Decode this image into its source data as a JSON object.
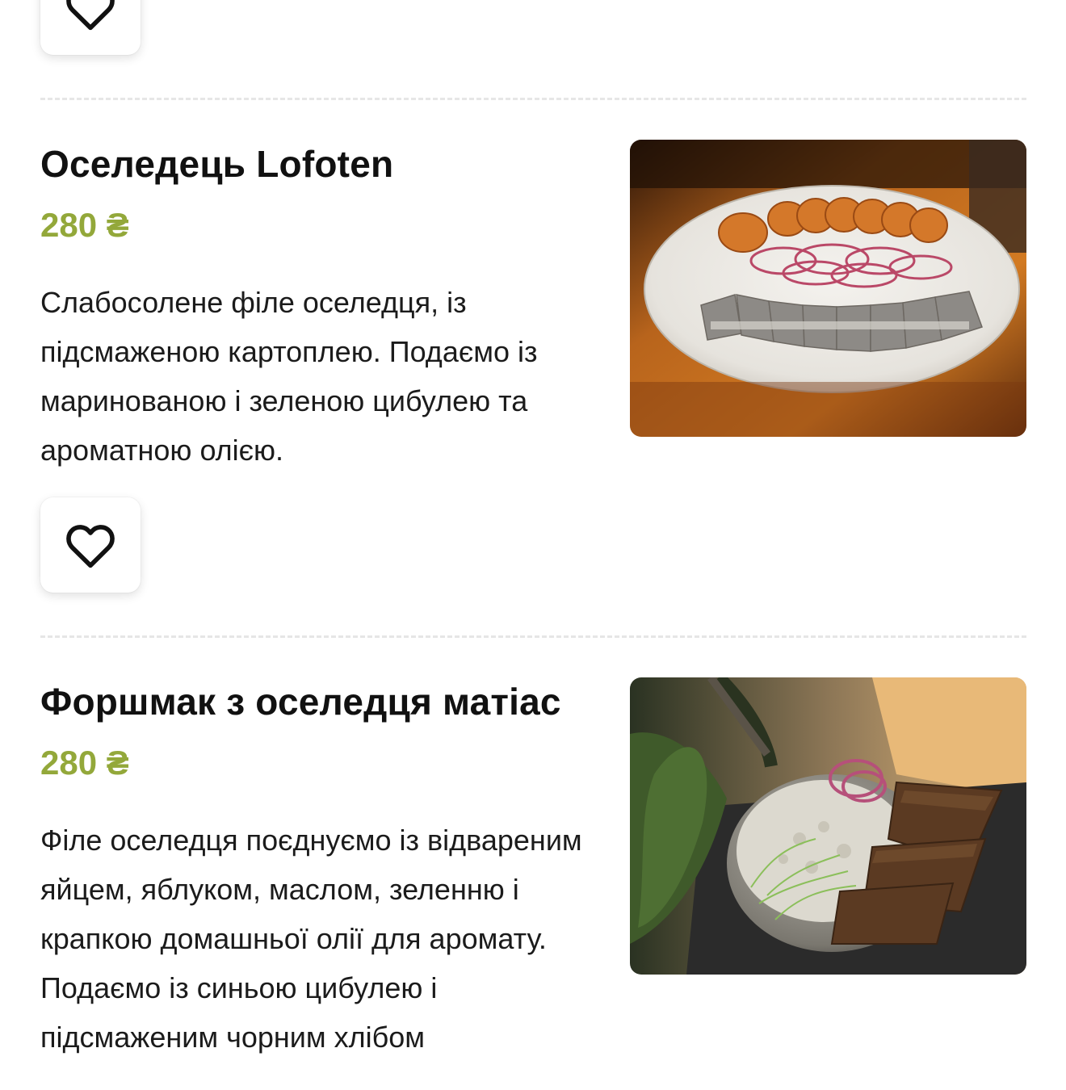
{
  "currency_symbol": "₴",
  "colors": {
    "price_accent": "#93a83a",
    "divider": "#e6e6e6",
    "text": "#151515"
  },
  "icons": {
    "favorite": "heart-outline-icon"
  },
  "menu_items": [
    {
      "title": "Оселедець Lofoten",
      "price": "280 ₴",
      "description": "Слабосолене філе оселедця, із підсмаженою картоплею. Подаємо із маринованою і зеленою цибулею та ароматною олією.",
      "photo": "herring-plate-with-potatoes-photo"
    },
    {
      "title": "Форшмак з оселедця матіас",
      "price": "280 ₴",
      "description": "Філе оселедця поєднуємо із відвареним яйцем, яблуком, маслом, зеленню і крапкою домашньої  олії для аромату. Подаємо із синьою цибулею і підсмаженим чорним хлібом",
      "photo": "forshmak-pan-with-rye-bread-photo"
    }
  ]
}
